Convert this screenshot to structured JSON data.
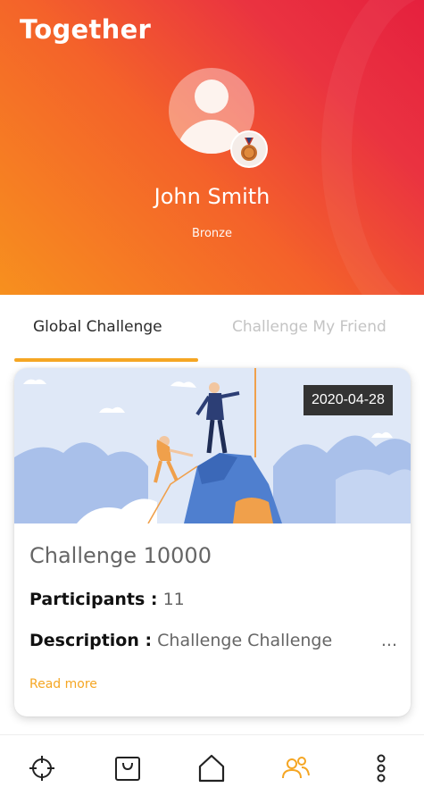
{
  "app": {
    "title": "Together"
  },
  "profile": {
    "name": "John Smith",
    "level": "Bronze"
  },
  "tabs": [
    {
      "label": "Global Challenge",
      "active": true
    },
    {
      "label": "Challenge My Friend",
      "active": false
    }
  ],
  "challenge": {
    "date": "2020-04-28",
    "title": "Challenge 10000",
    "participants_label": "Participants :",
    "participants_value": "11",
    "description_label": "Description :",
    "description_value": "Challenge Challenge",
    "ellipsis": "...",
    "read_more": "Read more"
  },
  "bottom_nav": {
    "items": [
      {
        "icon": "crosshair-icon",
        "active": false
      },
      {
        "icon": "shopping-bag-icon",
        "active": false
      },
      {
        "icon": "home-icon",
        "active": false
      },
      {
        "icon": "people-icon",
        "active": true
      },
      {
        "icon": "more-vertical-icon",
        "active": false
      }
    ]
  },
  "colors": {
    "accent": "#f5a623",
    "header_gradient_start": "#f7901e",
    "header_gradient_end": "#e5203e"
  }
}
